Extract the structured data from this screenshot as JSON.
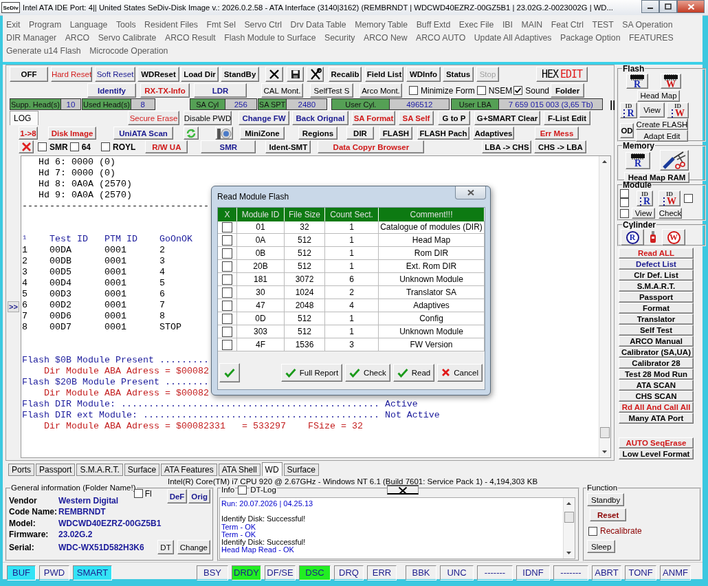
{
  "window": {
    "icon_text": "SeDiv",
    "title": "Intel ATA IDE  Port: 4|| United States  SeDiv-Disk Image v.: 2026.0.2.58 - ATA Interface (3140|3162)  (REMBRNDT | WDCWD40EZRZ-00GZ5B1 | 23.02G.2-0023002G | WD..."
  },
  "menu_rows": [
    [
      "Exit",
      "Program",
      "Language",
      "Tools",
      "Resident Files",
      "Fmt Sel",
      "Servo Ctrl",
      "Drv Data Table",
      "Memory Table",
      "Buff Extd",
      "Exec File",
      "IBI",
      "MAIN",
      "Feat Ctrl",
      "TEST",
      "SA Operation"
    ],
    [
      "DIR Manager",
      "ARCO",
      "Servo Calibrate",
      "ARCO Result",
      "Flash Module to Surface",
      "Security",
      "ARCO New",
      "ARCO AUTO",
      "Update All Adaptives",
      "Package Option",
      "FEATURES"
    ],
    [
      "Generate u14 Flash",
      "Microcode Operation"
    ]
  ],
  "toolbar_rows": [
    [
      {
        "kind": "button",
        "label": "OFF"
      },
      {
        "kind": "flatbutton",
        "label": "Hard Reset",
        "color": "#d42020"
      },
      {
        "kind": "flatbutton",
        "label": "Soft Reset",
        "color": "#1a1a90"
      },
      {
        "kind": "button",
        "label": "WDReset"
      },
      {
        "kind": "button",
        "label": "Load Dir"
      },
      {
        "kind": "button",
        "label": "StandBy"
      },
      {
        "kind": "icon-button"
      },
      {
        "kind": "icon-button"
      },
      {
        "kind": "icon-button"
      },
      {
        "kind": "button",
        "label": "Recalib"
      },
      {
        "kind": "button",
        "label": "Field List"
      },
      {
        "kind": "button",
        "label": "WDInfo"
      },
      {
        "kind": "button",
        "label": "Status"
      },
      {
        "kind": "disabled",
        "label": "Stop"
      },
      {
        "kind": "hexedit",
        "words": [
          "HEX",
          "EDIT"
        ]
      }
    ],
    [
      {
        "kind": "button",
        "label": "Identify",
        "color": "#1a1a90"
      },
      {
        "kind": "button",
        "label": "RX-TX-Info",
        "color": "#d01818"
      },
      {
        "kind": "button",
        "label": "LDR",
        "color": "#1a1a90"
      },
      {
        "kind": "flatbutton",
        "label": "CAL Mont."
      },
      {
        "kind": "flatbutton",
        "label": "SelfTest S"
      },
      {
        "kind": "flatbutton",
        "label": "Arco Mont."
      },
      {
        "kind": "check",
        "label": "Minimize Form",
        "checked": false
      },
      {
        "kind": "check",
        "label": "NSEM",
        "checked": false
      },
      {
        "kind": "check",
        "label": "Sound",
        "checked": true
      },
      {
        "kind": "button",
        "label": "Folder"
      }
    ],
    [
      {
        "kind": "counter",
        "label": "Supp. Head(s)",
        "value": "10"
      },
      {
        "kind": "counter",
        "label": "Used Head(s)",
        "value": "8"
      },
      {
        "kind": "counter",
        "label": "SA Cyl",
        "value": "256"
      },
      {
        "kind": "counter",
        "label": "SA SPT",
        "value": "2480"
      },
      {
        "kind": "counter",
        "label": "User Cyl.",
        "value": "496512"
      },
      {
        "kind": "counter",
        "label": "User LBA",
        "value": "7 659 015 003  (3,65 Tb)"
      },
      {
        "kind": "text",
        "text": "||"
      }
    ],
    [
      {
        "kind": "tab",
        "label": "LOG",
        "selected": true
      },
      {
        "kind": "flatbutton",
        "label": "Secure Erase",
        "color": "#d42020"
      },
      {
        "kind": "flatbutton",
        "label": "Disable PWD"
      },
      {
        "kind": "button",
        "label": "Change FW",
        "color": "#1a1a90"
      },
      {
        "kind": "button",
        "label": "Back Orignal",
        "color": "#1a1a90"
      },
      {
        "kind": "button",
        "label": "SA Format",
        "color": "#d01818"
      },
      {
        "kind": "button",
        "label": "SA Self",
        "color": "#d01818"
      },
      {
        "kind": "button",
        "label": "G to P"
      },
      {
        "kind": "button",
        "label": "G+SMART Clear"
      },
      {
        "kind": "button",
        "label": "F-List Edit"
      }
    ],
    [
      {
        "kind": "button",
        "label": "1->8",
        "color": "#d01818"
      },
      {
        "kind": "button",
        "label": "Disk Image",
        "color": "#d01818"
      },
      {
        "kind": "button",
        "label": "UniATA Scan",
        "color": "#1a1a90"
      },
      {
        "kind": "icon-button"
      },
      {
        "kind": "icon-button"
      },
      {
        "kind": "button",
        "label": "MiniZone"
      },
      {
        "kind": "button",
        "label": "Regions"
      },
      {
        "kind": "button",
        "label": "DIR"
      },
      {
        "kind": "button",
        "label": "FLASH"
      },
      {
        "kind": "button",
        "label": "FLASH Pach"
      },
      {
        "kind": "button",
        "label": "Adaptives"
      },
      {
        "kind": "button",
        "label": "Err Mess",
        "color": "#d01818"
      }
    ],
    [
      {
        "kind": "icon-button"
      },
      {
        "kind": "check",
        "label": "SMR",
        "checked": false
      },
      {
        "kind": "check",
        "label": "64",
        "checked": false
      },
      {
        "kind": "check",
        "label": "ROYL",
        "checked": false
      },
      {
        "kind": "button",
        "label": "R/W UA",
        "color": "#d01818"
      },
      {
        "kind": "button",
        "label": "SMR",
        "color": "#1a1a90"
      },
      {
        "kind": "button",
        "label": "Ident-SMT"
      },
      {
        "kind": "button",
        "label": "Data Copyr Browser",
        "color": "#d01818"
      },
      {
        "kind": "button",
        "label": "LBA -> CHS"
      },
      {
        "kind": "button",
        "label": "CHS -> LBA"
      }
    ]
  ],
  "log": {
    "expander": ">>",
    "blocks": [
      [
        {
          "text": "   Hd 6: 0000 (0)"
        },
        {
          "text": "   Hd 7: 0000 (0)"
        },
        {
          "text": "   Hd 8: 0A0A (2570)"
        },
        {
          "text": "   Hd 9: 0A0A (2570)"
        },
        {
          "text": "----------------------------------"
        }
      ],
      [
        {
          "text": "¹    Test ID   PTM ID    GoOnOK",
          "color": "#1c1c9c"
        },
        {
          "text": "1    00DA      0001      2"
        },
        {
          "text": "2    00DB      0001      3"
        },
        {
          "text": "3    00D5      0001      4"
        },
        {
          "text": "4    00D4      0001      5"
        },
        {
          "text": "5    00D3      0001      6"
        },
        {
          "text": "6    00D2      0001      7"
        },
        {
          "text": "7    00D6      0001      8"
        },
        {
          "text": "8    00D7      0001      STOP"
        }
      ],
      [
        {
          "text": "Flash $0B Module Present .........",
          "color": "#1c1c9c"
        },
        {
          "text": "    Dir Module ABA Adress = $00082",
          "color": "#c42020"
        },
        {
          "text": "Flash $20B Module Present ........",
          "color": "#1c1c9c"
        },
        {
          "text": "    Dir Module ABA Adress = $00082",
          "color": "#c42020"
        },
        {
          "text": "Flash DIR Module: ............................................... Active",
          "color": "#1c1c9c"
        },
        {
          "text": "Flash DIR ext Module: ........................................... Not Active",
          "color": "#1c1c9c"
        },
        {
          "text": "    Dir Module ABA Adress = $00082331   = 533297    FSize = 32",
          "color": "#c42020"
        }
      ]
    ]
  },
  "dialog": {
    "title": "Read Module Flash",
    "checkbox_column": "X",
    "columns": [
      "Module ID",
      "File Size",
      "Count Sect.",
      "Comment!!!"
    ],
    "rows": [
      {
        "checked": false,
        "cells": [
          "01",
          "32",
          "1",
          "Catalogue of modules (DIR)"
        ]
      },
      {
        "checked": false,
        "cells": [
          "0A",
          "512",
          "1",
          "Head Map"
        ]
      },
      {
        "checked": false,
        "cells": [
          "0B",
          "512",
          "1",
          "Rom DIR"
        ]
      },
      {
        "checked": false,
        "cells": [
          "20B",
          "512",
          "1",
          "Ext. Rom DIR"
        ]
      },
      {
        "checked": false,
        "cells": [
          "181",
          "3072",
          "6",
          "Unknown Module"
        ]
      },
      {
        "checked": false,
        "cells": [
          "30",
          "1024",
          "2",
          "Translator SA"
        ]
      },
      {
        "checked": false,
        "cells": [
          "47",
          "2048",
          "4",
          "Adaptives"
        ]
      },
      {
        "checked": false,
        "cells": [
          "0D",
          "512",
          "1",
          "Config"
        ]
      },
      {
        "checked": false,
        "cells": [
          "303",
          "512",
          "1",
          "Unknown Module"
        ]
      },
      {
        "checked": false,
        "cells": [
          "4F",
          "1536",
          "3",
          "FW Version"
        ]
      }
    ],
    "buttons": [
      {
        "label": "Full Report",
        "kind": "ok"
      },
      {
        "label": "Check",
        "kind": "ok"
      },
      {
        "label": "Read",
        "kind": "ok"
      },
      {
        "label": "Cancel",
        "kind": "cancel"
      }
    ]
  },
  "side": {
    "flash": {
      "title": "Flash",
      "read": "R",
      "write": "W",
      "head_map": "Head Map",
      "id_read_tag": "ID",
      "id_read": "R",
      "view": "View",
      "id_write_tag": "ID",
      "id_write": "W",
      "od": "OD",
      "create": "Create FLASH",
      "adapt": "Adapt Edit"
    },
    "memory": {
      "title": "Memory",
      "read": "R",
      "head_map_ram": "Head Map RAM"
    },
    "module": {
      "title": "Module",
      "id_read_tag": "ID",
      "id_read": "R",
      "id_write_tag": "ID",
      "id_write": "W",
      "view": "View",
      "check": "Check",
      "checks": [
        {
          "checked": false
        },
        {
          "checked": false
        },
        {
          "checked": false
        },
        {
          "checked": false
        }
      ]
    },
    "cylinder": {
      "title": "Cylinder",
      "read": "R",
      "write": "W"
    },
    "actions": [
      {
        "label": "Read ALL",
        "color": "#d01818"
      },
      {
        "label": "Defect List",
        "color": "#1a1a90"
      },
      {
        "label": "Clr Def. List"
      },
      {
        "label": "S.M.A.R.T."
      },
      {
        "label": "Passport"
      },
      {
        "label": "Format"
      },
      {
        "label": "Translator"
      },
      {
        "label": "Self Test"
      },
      {
        "label": "ARCO Manual"
      },
      {
        "label": "Calibrator (SA,UA)"
      },
      {
        "label": "Calibrator 28"
      },
      {
        "label": "Test 28 Mod Run"
      },
      {
        "label": "ATA SCAN"
      },
      {
        "label": "CHS SCAN"
      },
      {
        "label": "Rd All And Call All",
        "color": "#d01818"
      },
      {
        "label": "Many ATA Port"
      }
    ],
    "bottom_actions": [
      {
        "label": "AUTO SeqErase",
        "color": "#d01818"
      },
      {
        "label": "Low Level Format"
      }
    ]
  },
  "bottom_tabs": [
    {
      "label": "Ports",
      "selected": false
    },
    {
      "label": "Passport",
      "selected": false
    },
    {
      "label": "S.M.A.R.T.",
      "selected": false
    },
    {
      "label": "Surface",
      "selected": false
    },
    {
      "label": "ATA Features",
      "selected": false
    },
    {
      "label": "ATA Shell",
      "selected": false
    },
    {
      "label": "WD",
      "selected": true
    },
    {
      "label": "Surface",
      "selected": false
    }
  ],
  "system_line": "Intel(R) Core(TM) i7 CPU 920  @ 2.67GHz - Windows NT 6.1 (Build 7601: Service Pack 1) -  4,194,303 KB",
  "general": {
    "title": "General information (Folder Name!)",
    "fl": {
      "label": "Fl",
      "checked": false
    },
    "def": "DeF",
    "orig": "Orig",
    "dt": "DT",
    "change": "Change",
    "fields": [
      {
        "label": "Vendor",
        "value": "Western Digital"
      },
      {
        "label": "Code Name:",
        "value": "REMBRNDT"
      },
      {
        "label": "Model:",
        "value": "WDCWD40EZRZ-00GZ5B1"
      },
      {
        "label": "Firmware:",
        "value": "23.02G.2"
      },
      {
        "label": "Serial:",
        "value": "WDC-WX51D582H3K6"
      }
    ]
  },
  "info": {
    "title": "Info",
    "dt_log": {
      "label": "DT-Log",
      "checked": false
    },
    "blocks": [
      [
        {
          "text": "Run: 20.07.2026 | 04.25.13",
          "color": "#0000cc"
        }
      ],
      [
        {
          "text": "Identify Disk: Successful!"
        },
        {
          "text": "Term - OK",
          "color": "#0000cc"
        },
        {
          "text": "Term - OK",
          "color": "#0000cc"
        },
        {
          "text": "Identify Disk: Successful!"
        },
        {
          "text": "Head Map Read - OK",
          "color": "#0000cc"
        }
      ]
    ]
  },
  "function": {
    "title": "Function",
    "standby": "Standby",
    "reset": "Reset",
    "recalibrate": {
      "label": "Recalibrate",
      "checked": false
    },
    "sleep": "Sleep"
  },
  "status_groups": [
    [
      {
        "label": "BUF",
        "lit": true,
        "color": "#33e3f5"
      },
      {
        "label": "PWD",
        "lit": false
      },
      {
        "label": "SMART",
        "lit": true,
        "color": "#33e3f5"
      }
    ],
    [
      {
        "label": "BSY",
        "lit": false
      },
      {
        "label": "DRDY",
        "lit": true,
        "color": "#22ee22"
      },
      {
        "label": "DF/SE",
        "lit": false
      },
      {
        "label": "DSC",
        "lit": true,
        "color": "#22ee22"
      },
      {
        "label": "DRQ",
        "lit": false
      },
      {
        "label": "ERR",
        "lit": false
      }
    ],
    [
      {
        "label": "BBK",
        "lit": false
      },
      {
        "label": "UNC",
        "lit": false
      },
      {
        "label": "-------",
        "lit": false
      },
      {
        "label": "IDNF",
        "lit": false
      },
      {
        "label": "-------",
        "lit": false
      },
      {
        "label": "ABRT",
        "lit": false
      },
      {
        "label": "TONF",
        "lit": false
      },
      {
        "label": "ANMF",
        "lit": false
      }
    ]
  ]
}
